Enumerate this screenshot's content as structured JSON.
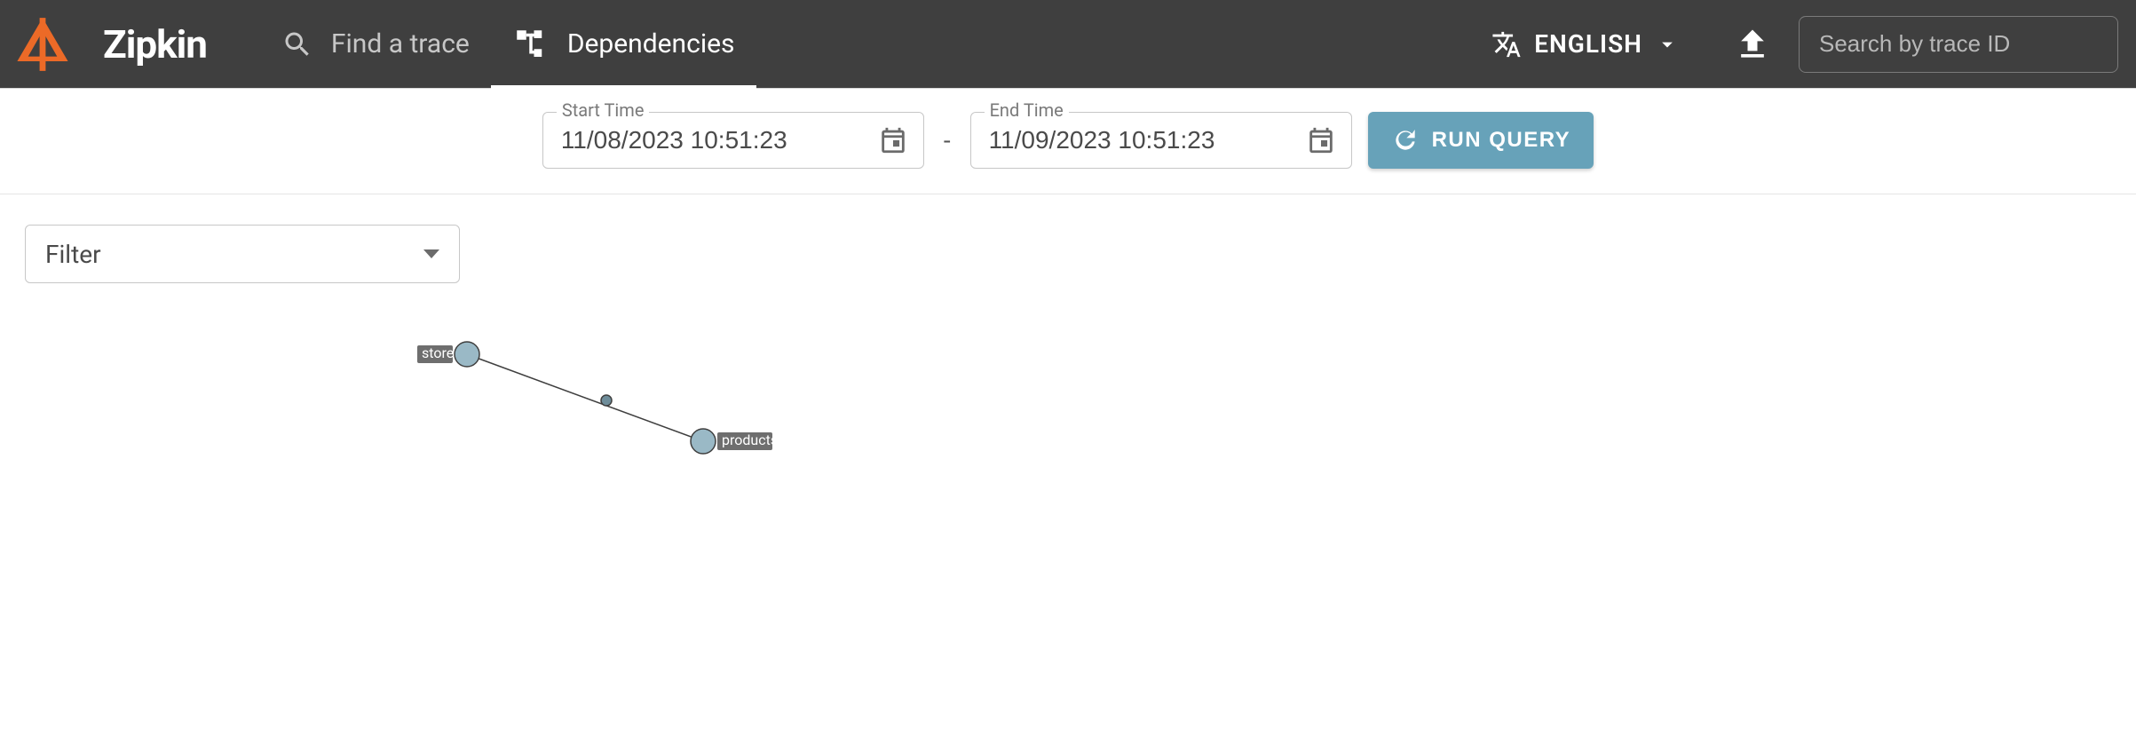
{
  "app": {
    "title": "Zipkin"
  },
  "nav": {
    "find_label": "Find a trace",
    "dependencies_label": "Dependencies"
  },
  "lang": {
    "name": "ENGLISH"
  },
  "search": {
    "placeholder": "Search by trace ID"
  },
  "query": {
    "start_label": "Start Time",
    "start_value": "11/08/2023 10:51:23",
    "end_label": "End Time",
    "end_value": "11/09/2023 10:51:23",
    "dash": "-",
    "run_label": "RUN QUERY"
  },
  "filter": {
    "label": "Filter"
  },
  "graph": {
    "nodes": [
      {
        "id": "store",
        "label": "store"
      },
      {
        "id": "products",
        "label": "products"
      }
    ],
    "edges": [
      {
        "from": "store",
        "to": "products"
      }
    ]
  }
}
